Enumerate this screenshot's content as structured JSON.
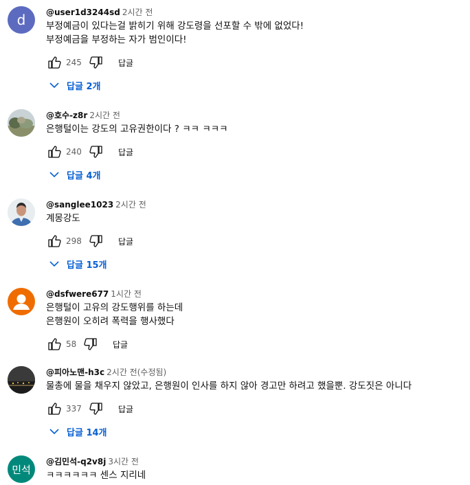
{
  "comments": [
    {
      "author": "@user1d3244sd",
      "time": "2시간 전",
      "avatar_letter": "d",
      "avatar_color": "#5c6bc0",
      "lines": [
        "부정예금이 있다는걸 밝히기 위해 강도령을 선포할 수 밖에 없었다!",
        "부정예금을 부정하는 자가 범인이다!"
      ],
      "likes": "245",
      "reply_label": "답글",
      "replies_label": "답글 2개"
    },
    {
      "author": "@호수-z8r",
      "time": "2시간 전",
      "avatar_kind": "photo-landscape",
      "lines": [
        "은행털이는 강도의 고유권한이다 ? ㅋㅋ ㅋㅋㅋ"
      ],
      "likes": "240",
      "reply_label": "답글",
      "replies_label": "답글 4개"
    },
    {
      "author": "@sanglee1023",
      "time": "2시간 전",
      "avatar_kind": "photo-person",
      "lines": [
        "계몽강도"
      ],
      "likes": "298",
      "reply_label": "답글",
      "replies_label": "답글 15개"
    },
    {
      "author": "@dsfwere677",
      "time": "1시간 전",
      "avatar_kind": "default-person",
      "avatar_color": "#ef6c00",
      "lines": [
        "은행털이 고유의 강도행위를 하는데",
        "은행원이 오히려 폭력을 행사했다"
      ],
      "likes": "58",
      "reply_label": "답글"
    },
    {
      "author": "@피아노맨-h3c",
      "time": "2시간 전(수정됨)",
      "avatar_kind": "photo-night",
      "lines": [
        "물총에 물을 채우지 않았고, 은행원이 인사를 하지 않아 경고만 하려고 했을뿐. 강도짓은 아니다"
      ],
      "likes": "337",
      "reply_label": "답글",
      "replies_label": "답글 14개"
    },
    {
      "author": "@김민석-q2v8j",
      "time": "3시간 전",
      "avatar_letter": "민석",
      "avatar_color": "#00897b",
      "lines": [
        "ㅋㅋㅋㅋㅋㅋ 센스 지리네"
      ]
    }
  ],
  "colors": {
    "link_blue": "#065fd4",
    "meta_gray": "#606060"
  },
  "icons": [
    "thumb-up-icon",
    "thumb-down-icon",
    "chevron-down-icon"
  ]
}
